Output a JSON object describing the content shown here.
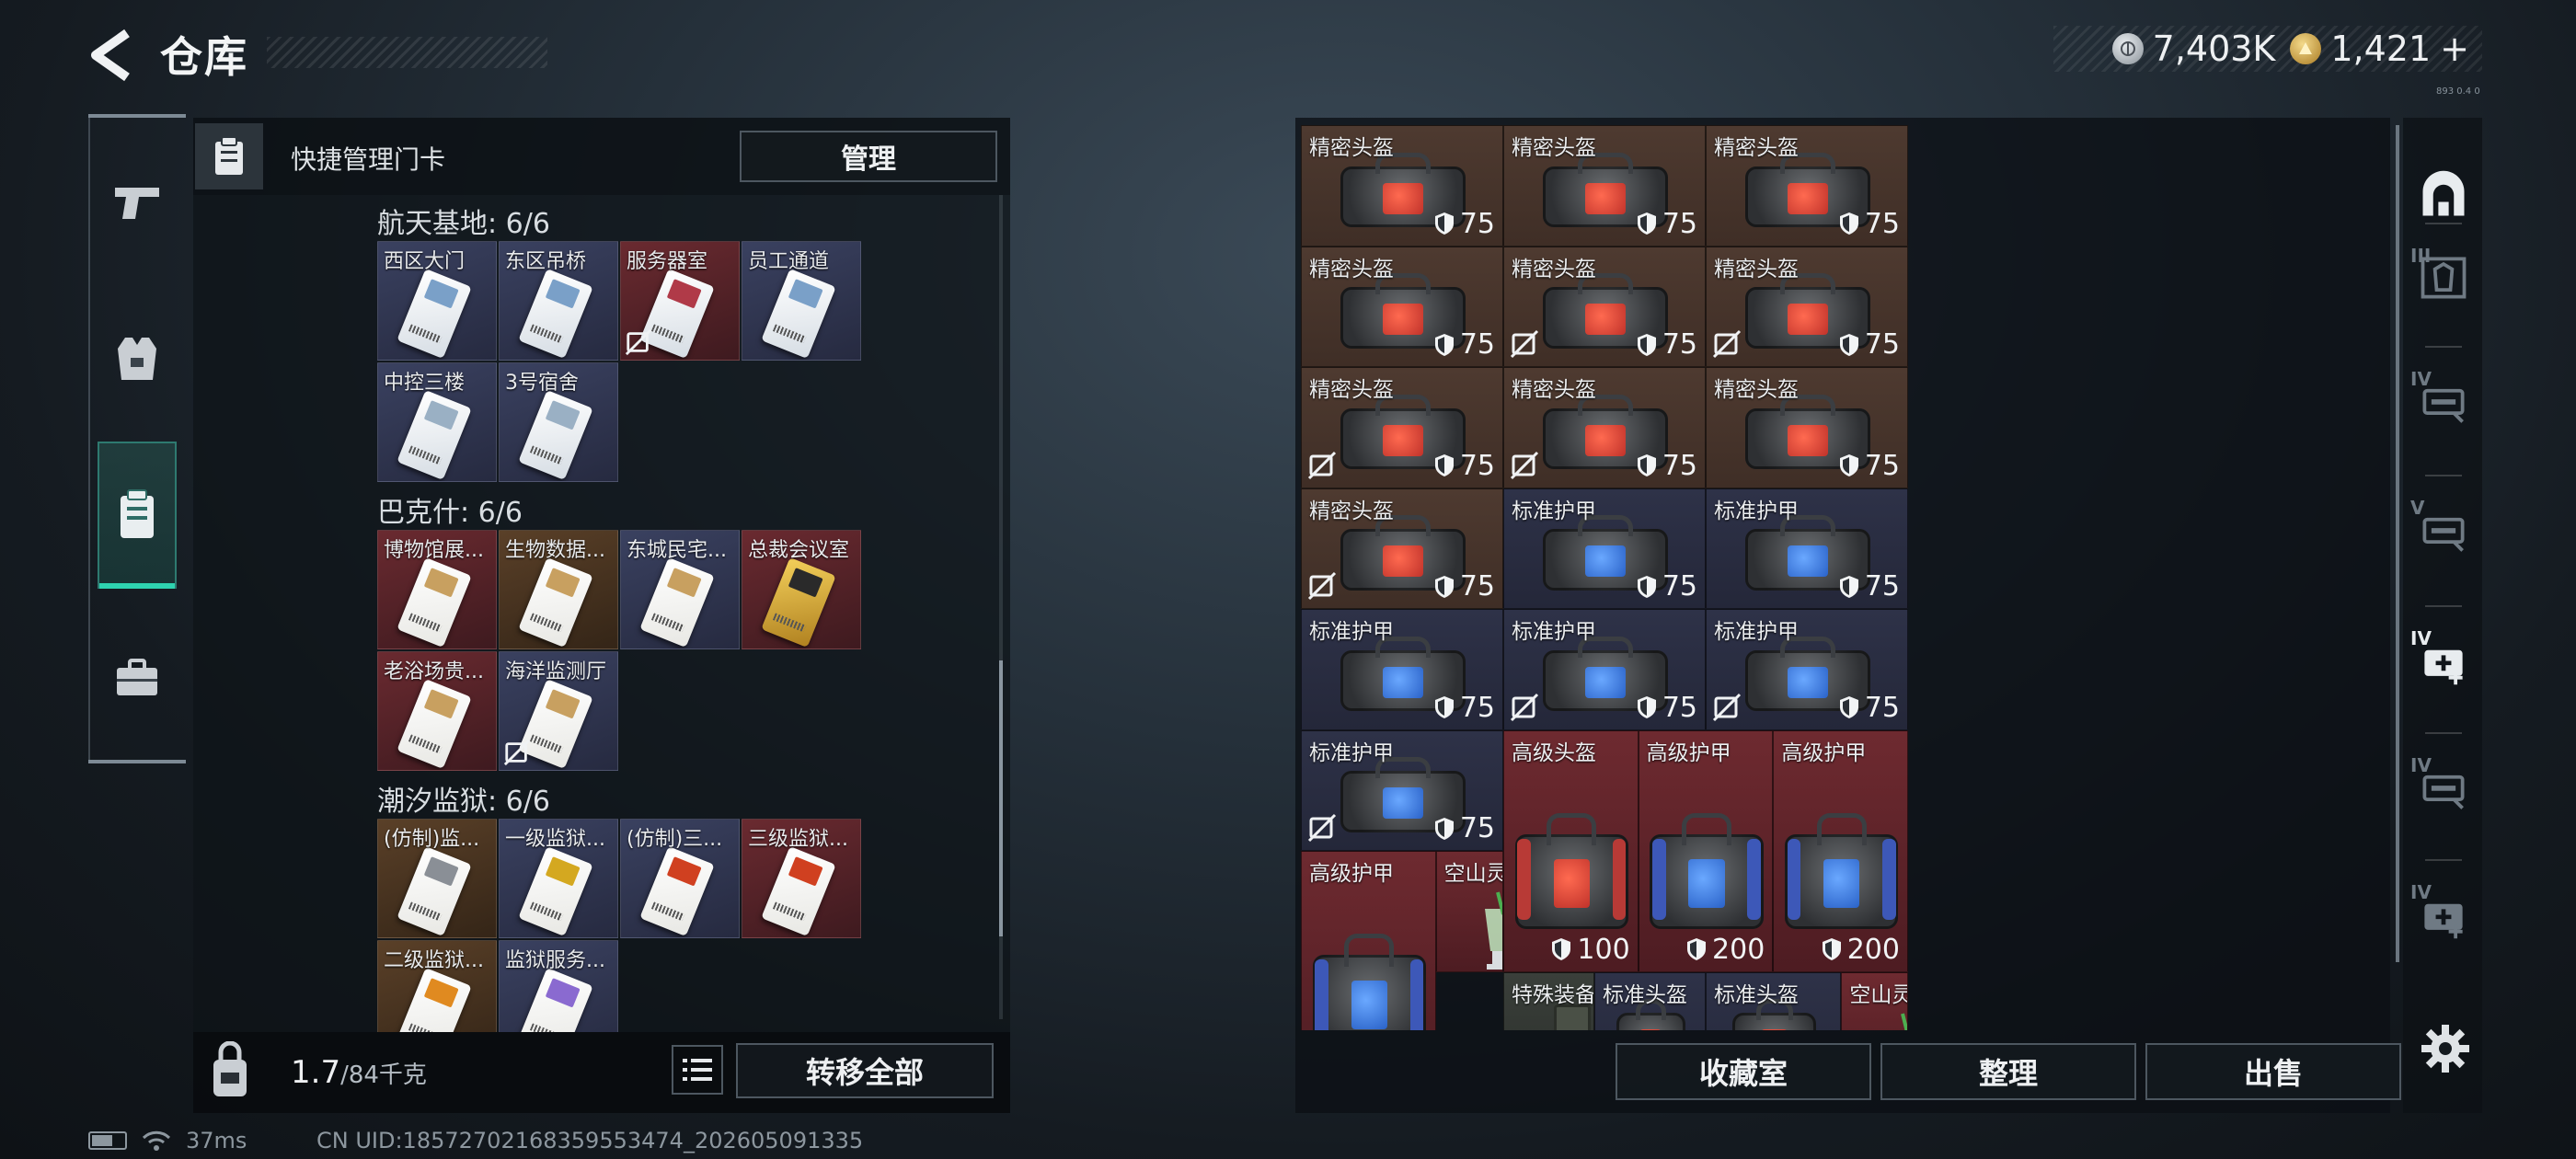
{
  "header": {
    "title": "仓库"
  },
  "currency": {
    "silver": "7,403K",
    "gold": "1,421",
    "plus": "+"
  },
  "version": "893 0.4 0",
  "left_panel": {
    "header_label": "快捷管理门卡",
    "manage_label": "管理",
    "sections": [
      {
        "title": "航天基地: 6/6",
        "cards": [
          {
            "name": "西区大门",
            "tint": "b",
            "card": "#d6dde4",
            "stripe": "#7aa0c8",
            "unusable": false
          },
          {
            "name": "东区吊桥",
            "tint": "b",
            "card": "#d6dde4",
            "stripe": "#7aa0c8",
            "unusable": false
          },
          {
            "name": "服务器室",
            "tint": "r",
            "card": "#d6dde4",
            "stripe": "#b03a48",
            "unusable": true
          },
          {
            "name": "员工通道",
            "tint": "b",
            "card": "#d6dde4",
            "stripe": "#7aa0c8",
            "unusable": false
          },
          {
            "name": "中控三楼",
            "tint": "b",
            "card": "#d6dde4",
            "stripe": "#9ab0c4",
            "unusable": false
          },
          {
            "name": "3号宿舍",
            "tint": "b",
            "card": "#d6dde4",
            "stripe": "#9ab0c4",
            "unusable": false
          }
        ]
      },
      {
        "title": "巴克什: 6/6",
        "cards": [
          {
            "name": "博物馆展...",
            "tint": "r",
            "card": "#e8e8e4",
            "stripe": "#c8a060",
            "unusable": false
          },
          {
            "name": "生物数据...",
            "tint": "o",
            "card": "#e8e8e4",
            "stripe": "#c8a060",
            "unusable": false
          },
          {
            "name": "东城民宅...",
            "tint": "b",
            "card": "#e8e8e4",
            "stripe": "#c8a060",
            "unusable": false
          },
          {
            "name": "总裁会议室",
            "tint": "r",
            "card": "gold",
            "stripe": "#2a2a2a",
            "unusable": false
          },
          {
            "name": "老浴场贵...",
            "tint": "r",
            "card": "#e8e8e4",
            "stripe": "#c8a060",
            "unusable": false
          },
          {
            "name": "海洋监测厅",
            "tint": "b",
            "card": "#e8e8e4",
            "stripe": "#c8a060",
            "unusable": true
          }
        ]
      },
      {
        "title": "潮汐监狱: 6/6",
        "cards": [
          {
            "name": "(仿制)监...",
            "tint": "o",
            "card": "#e8e8e4",
            "stripe": "#8a8f96",
            "unusable": false
          },
          {
            "name": "一级监狱...",
            "tint": "b",
            "card": "#e8e8e4",
            "stripe": "#d4a820",
            "unusable": false
          },
          {
            "name": "(仿制)三...",
            "tint": "b",
            "card": "#e8e8e4",
            "stripe": "#d04020",
            "unusable": false
          },
          {
            "name": "三级监狱...",
            "tint": "r",
            "card": "#e8e8e4",
            "stripe": "#d04020",
            "unusable": false
          },
          {
            "name": "二级监狱...",
            "tint": "o",
            "card": "#e8e8e4",
            "stripe": "#e08a20",
            "unusable": false
          },
          {
            "name": "监狱服务...",
            "tint": "b",
            "card": "#e8e8e4",
            "stripe": "#8a6ad0",
            "unusable": false
          }
        ]
      }
    ],
    "weight": "1.7",
    "weight_cap": "/84千克",
    "transfer_all": "转移全部"
  },
  "status": {
    "ping": "37ms",
    "uid": "CN UID:18572702168359553474_202605091335"
  },
  "stash": {
    "items": [
      {
        "name": "精密头盔",
        "kind": "helmet",
        "tint": "o",
        "dur": "75",
        "unusable": false
      },
      {
        "name": "精密头盔",
        "kind": "helmet",
        "tint": "o",
        "dur": "75",
        "unusable": false
      },
      {
        "name": "精密头盔",
        "kind": "helmet",
        "tint": "o",
        "dur": "75",
        "unusable": false
      },
      {
        "name": "精密头盔",
        "kind": "helmet",
        "tint": "o",
        "dur": "75",
        "unusable": false
      },
      {
        "name": "精密头盔",
        "kind": "helmet",
        "tint": "o",
        "dur": "75",
        "unusable": true
      },
      {
        "name": "精密头盔",
        "kind": "helmet",
        "tint": "o",
        "dur": "75",
        "unusable": true
      },
      {
        "name": "精密头盔",
        "kind": "helmet",
        "tint": "o",
        "dur": "75",
        "unusable": true
      },
      {
        "name": "精密头盔",
        "kind": "helmet",
        "tint": "o",
        "dur": "75",
        "unusable": true
      },
      {
        "name": "精密头盔",
        "kind": "helmet",
        "tint": "o",
        "dur": "75",
        "unusable": false
      },
      {
        "name": "精密头盔",
        "kind": "helmet",
        "tint": "o",
        "dur": "75",
        "unusable": true
      },
      {
        "name": "标准护甲",
        "kind": "armor",
        "tint": "b",
        "dur": "75",
        "unusable": false
      },
      {
        "name": "标准护甲",
        "kind": "armor",
        "tint": "b",
        "dur": "75",
        "unusable": false
      },
      {
        "name": "标准护甲",
        "kind": "armor",
        "tint": "b",
        "dur": "75",
        "unusable": false
      },
      {
        "name": "标准护甲",
        "kind": "armor",
        "tint": "b",
        "dur": "75",
        "unusable": true
      },
      {
        "name": "标准护甲",
        "kind": "armor",
        "tint": "b",
        "dur": "75",
        "unusable": true
      },
      {
        "name": "标准护甲",
        "kind": "armor",
        "tint": "b",
        "dur": "75",
        "unusable": true
      },
      {
        "name": "高级头盔",
        "kind": "helmet-big",
        "tint": "r",
        "dur": "100",
        "unusable": false
      },
      {
        "name": "高级护甲",
        "kind": "armor-big",
        "tint": "r",
        "dur": "200",
        "unusable": false
      },
      {
        "name": "高级护甲",
        "kind": "armor-big",
        "tint": "r",
        "dur": "200",
        "unusable": false
      },
      {
        "name": "高级护甲",
        "kind": "armor-big",
        "tint": "r",
        "dur": "",
        "unusable": false
      },
      {
        "name": "空山灵雨",
        "kind": "drink",
        "tint": "r",
        "dur": "",
        "unusable": false
      },
      {
        "name": "特殊装备补给",
        "kind": "supply",
        "tint": "g",
        "dur": "",
        "unusable": false
      },
      {
        "name": "标准头盔",
        "kind": "helmet",
        "tint": "b",
        "dur": "",
        "unusable": false
      },
      {
        "name": "标准头盔",
        "kind": "helmet",
        "tint": "b",
        "dur": "",
        "unusable": false
      },
      {
        "name": "空山灵雨",
        "kind": "drink",
        "tint": "r",
        "dur": "",
        "unusable": false
      }
    ],
    "collection_label": "收藏室",
    "sort_label": "整理",
    "sell_label": "出售"
  },
  "right_rail": {
    "items": [
      {
        "icon": "safehouse-icon",
        "label": ""
      },
      {
        "icon": "armor-rack-icon",
        "label": "III"
      },
      {
        "icon": "weapon-rack-icon",
        "label": "IV"
      },
      {
        "icon": "weapon-rack-icon",
        "label": "V"
      },
      {
        "icon": "medical-rack-icon",
        "label": "IV"
      },
      {
        "icon": "weapon-rack-icon",
        "label": "IV"
      },
      {
        "icon": "medical-rack-icon",
        "label": "IV"
      }
    ]
  },
  "colors": {
    "accent": "#2ed3b0",
    "tile_orange": "#4e3a30",
    "tile_blue": "#2e3248",
    "tile_red": "#6e2a30"
  }
}
